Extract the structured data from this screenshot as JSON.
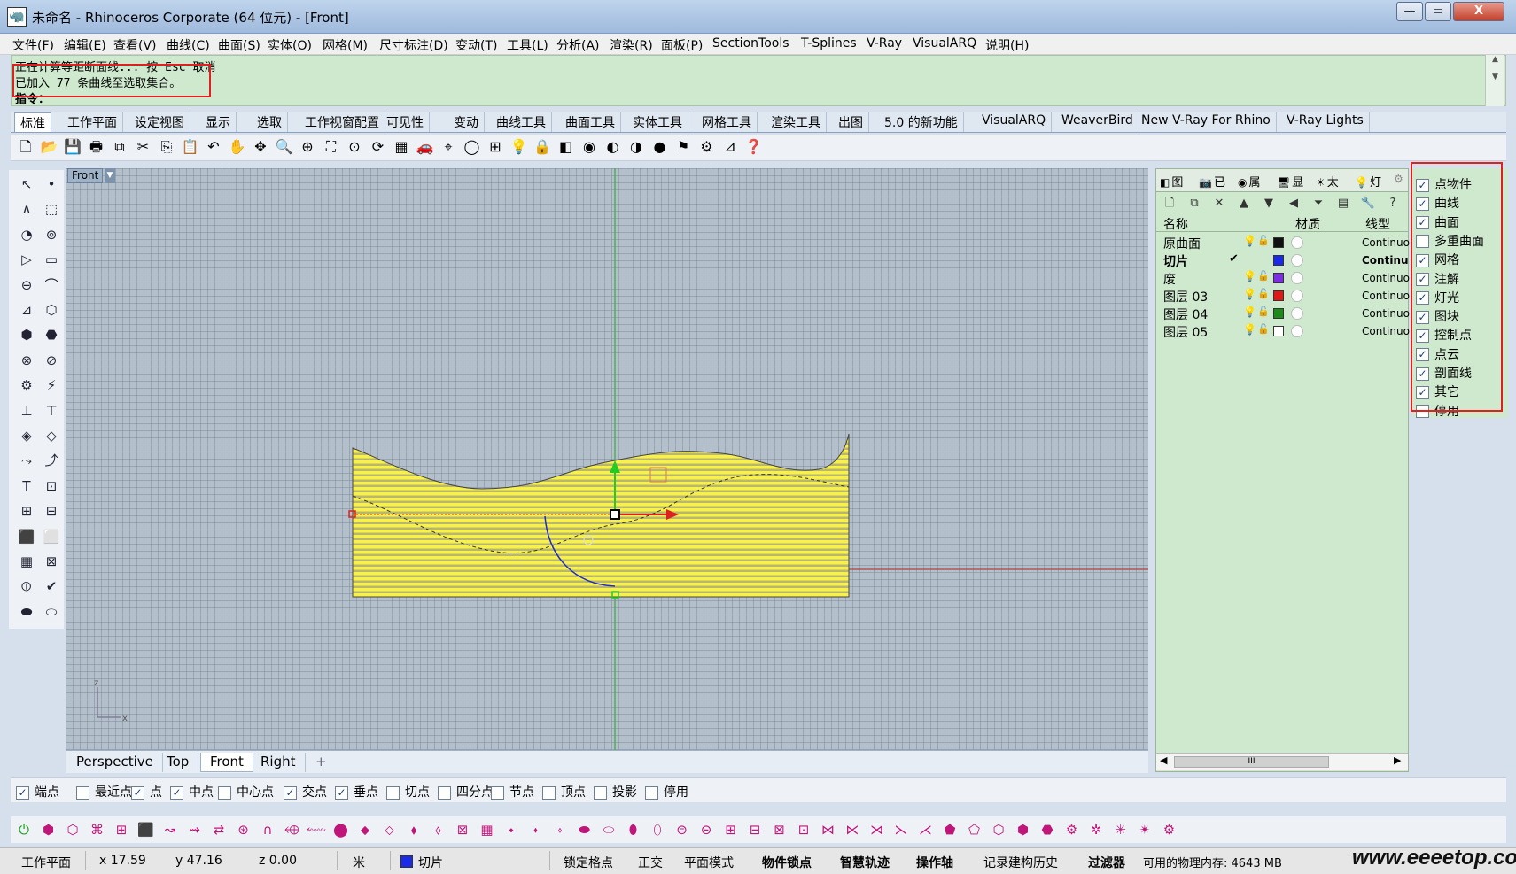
{
  "window": {
    "title": "未命名 - Rhinoceros Corporate (64 位元) - [Front]",
    "min_glyph": "—",
    "max_glyph": "▭",
    "close_glyph": "X"
  },
  "menu": [
    "文件(F)",
    "编辑(E)",
    "查看(V)",
    "曲线(C)",
    "曲面(S)",
    "实体(O)",
    "网格(M)",
    "尺寸标注(D)",
    "变动(T)",
    "工具(L)",
    "分析(A)",
    "渲染(R)",
    "面板(P)",
    "SectionTools",
    "T-Splines",
    "V-Ray",
    "VisualARQ",
    "说明(H)"
  ],
  "command": {
    "line1": "正在计算等距断面线... 按 Esc 取消",
    "line2": "已加入 77 条曲线至选取集合。",
    "prompt": "指令："
  },
  "toolbar_tabs": [
    "标准",
    "工作平面",
    "设定视图",
    "显示",
    "选取",
    "工作视窗配置",
    "可见性",
    "变动",
    "曲线工具",
    "曲面工具",
    "实体工具",
    "网格工具",
    "渲染工具",
    "出图",
    "5.0 的新功能",
    "VisualARQ",
    "WeaverBird",
    "New V-Ray For Rhino",
    "V-Ray Lights"
  ],
  "active_toolbar_tab": "标准",
  "toolbar_icons": [
    "new-icon",
    "open-icon",
    "save-icon",
    "print-icon",
    "import-icon",
    "cut-icon",
    "copy-icon",
    "paste-icon",
    "undo-icon",
    "pan-icon",
    "move-view-icon",
    "zoom-icon",
    "zoom-window-icon",
    "zoom-extents-icon",
    "zoom-selected-icon",
    "rotate-view-icon",
    "viewport-layout-icon",
    "car-icon",
    "select-icon",
    "circle-icon",
    "grid-icon",
    "lightbulb-icon",
    "lock-icon",
    "layer-icon",
    "color-wheel-icon",
    "render-icon",
    "shade-icon",
    "sphere-icon",
    "flag-icon",
    "gear-icon",
    "dimension-icon",
    "help-icon"
  ],
  "viewport": {
    "label": "Front",
    "tabs": [
      "Perspective",
      "Top",
      "Front",
      "Right"
    ],
    "active_tab": "Front",
    "axis_x": "x",
    "axis_z": "z",
    "add_tab": "+"
  },
  "layer_panel": {
    "tabs": [
      "图",
      "已",
      "属",
      "显",
      "太",
      "灯"
    ],
    "columns": {
      "name": "名称",
      "material": "材质",
      "linetype": "线型"
    },
    "layers": [
      {
        "name": "原曲面",
        "current": false,
        "visible": true,
        "color": "#111111",
        "linetype": "Continuo"
      },
      {
        "name": "切片",
        "current": true,
        "visible": true,
        "color": "#1a2ae8",
        "linetype": "Continu"
      },
      {
        "name": "废",
        "current": false,
        "visible": true,
        "color": "#7b2fe0",
        "linetype": "Continuo"
      },
      {
        "name": "图层 03",
        "current": false,
        "visible": true,
        "color": "#e01818",
        "linetype": "Continuo"
      },
      {
        "name": "图层 04",
        "current": false,
        "visible": true,
        "color": "#1b8a1b",
        "linetype": "Continuo"
      },
      {
        "name": "图层 05",
        "current": false,
        "visible": true,
        "color": "#ffffff",
        "linetype": "Continuo"
      }
    ],
    "current_mark": "✔",
    "scroll_thumb": "III"
  },
  "visibility": [
    {
      "label": "点物件",
      "checked": true
    },
    {
      "label": "曲线",
      "checked": true
    },
    {
      "label": "曲面",
      "checked": true
    },
    {
      "label": "多重曲面",
      "checked": false
    },
    {
      "label": "网格",
      "checked": true
    },
    {
      "label": "注解",
      "checked": true
    },
    {
      "label": "灯光",
      "checked": true
    },
    {
      "label": "图块",
      "checked": true
    },
    {
      "label": "控制点",
      "checked": true
    },
    {
      "label": "点云",
      "checked": true
    },
    {
      "label": "剖面线",
      "checked": true
    },
    {
      "label": "其它",
      "checked": true
    },
    {
      "label": "停用",
      "checked": false
    }
  ],
  "osnaps": [
    {
      "label": "端点",
      "checked": true
    },
    {
      "label": "最近点",
      "checked": false
    },
    {
      "label": "点",
      "checked": true
    },
    {
      "label": "中点",
      "checked": true
    },
    {
      "label": "中心点",
      "checked": false
    },
    {
      "label": "交点",
      "checked": true
    },
    {
      "label": "垂点",
      "checked": true
    },
    {
      "label": "切点",
      "checked": false
    },
    {
      "label": "四分点",
      "checked": false
    },
    {
      "label": "节点",
      "checked": false
    },
    {
      "label": "顶点",
      "checked": false
    },
    {
      "label": "投影",
      "checked": false
    },
    {
      "label": "停用",
      "checked": false
    }
  ],
  "status": {
    "cplane": "工作平面",
    "x": "x 17.59",
    "y": "y 47.16",
    "z": "z 0.00",
    "unit": "米",
    "layer": "切片",
    "layer_color": "#1a2ae8",
    "grid_snap": "锁定格点",
    "ortho": "正交",
    "planar": "平面模式",
    "osnap": "物件锁点",
    "smart_track": "智慧轨迹",
    "gumball": "操作轴",
    "history": "记录建构历史",
    "filter": "过滤器",
    "memory": "可用的物理内存: 4643 MB"
  },
  "watermark": "www.eeeetop.com"
}
